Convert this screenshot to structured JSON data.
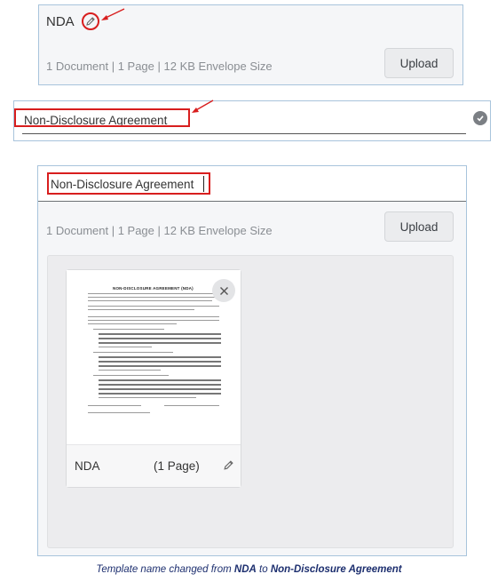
{
  "panel1": {
    "name": "NDA",
    "meta": "1 Document | 1 Page | 12 KB Envelope Size",
    "upload_label": "Upload"
  },
  "panel2": {
    "field_value": "Non-Disclosure Agreement"
  },
  "panel3": {
    "field_value": "Non-Disclosure Agreement",
    "meta": "1 Document | 1 Page | 12 KB Envelope Size",
    "upload_label": "Upload",
    "card": {
      "name": "NDA",
      "pages": "(1 Page)",
      "thumbnail_title": "NON-DISCLOSURE AGREEMENT (NDA)"
    }
  },
  "caption": {
    "prefix": "Template name changed from ",
    "old_name": "NDA",
    "middle": " to ",
    "new_name": "Non-Disclosure Agreement"
  },
  "colors": {
    "annotation_red": "#d81e1e",
    "panel_border": "#a8c4dc",
    "caption_blue": "#1d2f6f"
  },
  "icons": [
    "pencil-icon",
    "check-circle-icon",
    "close-icon",
    "red-arrow"
  ]
}
